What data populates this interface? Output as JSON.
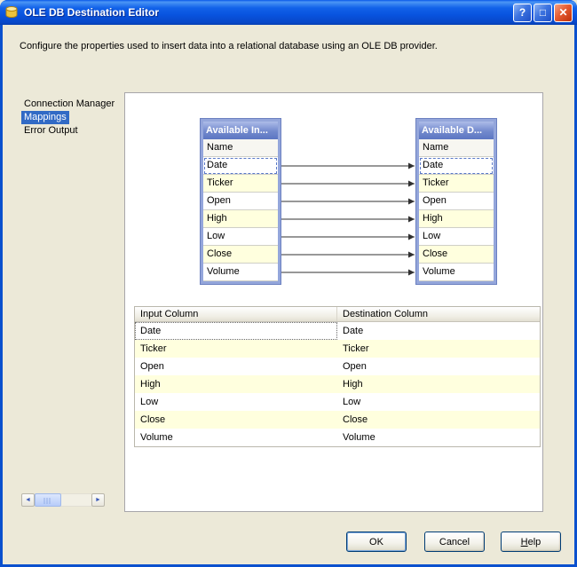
{
  "window": {
    "title": "OLE DB Destination Editor",
    "description": "Configure the properties used to insert data into a relational database using an OLE DB provider.",
    "controls": {
      "help_glyph": "?",
      "maximize_glyph": "□",
      "close_glyph": "✕"
    }
  },
  "sidebar": {
    "items": [
      {
        "label": "Connection Manager",
        "selected": false
      },
      {
        "label": "Mappings",
        "selected": true
      },
      {
        "label": "Error Output",
        "selected": false
      }
    ]
  },
  "mapping": {
    "source_box": {
      "title": "Available In...",
      "header": "Name",
      "rows": [
        "Date",
        "Ticker",
        "Open",
        "High",
        "Low",
        "Close",
        "Volume"
      ]
    },
    "dest_box": {
      "title": "Available D...",
      "header": "Name",
      "rows": [
        "Date",
        "Ticker",
        "Open",
        "High",
        "Low",
        "Close",
        "Volume"
      ]
    },
    "connections": [
      [
        "Date",
        "Date"
      ],
      [
        "Ticker",
        "Ticker"
      ],
      [
        "Open",
        "Open"
      ],
      [
        "High",
        "High"
      ],
      [
        "Low",
        "Low"
      ],
      [
        "Close",
        "Close"
      ],
      [
        "Volume",
        "Volume"
      ]
    ]
  },
  "grid": {
    "columns": [
      "Input Column",
      "Destination Column"
    ],
    "rows": [
      {
        "input": "Date",
        "destination": "Date"
      },
      {
        "input": "Ticker",
        "destination": "Ticker"
      },
      {
        "input": "Open",
        "destination": "Open"
      },
      {
        "input": "High",
        "destination": "High"
      },
      {
        "input": "Low",
        "destination": "Low"
      },
      {
        "input": "Close",
        "destination": "Close"
      },
      {
        "input": "Volume",
        "destination": "Volume"
      }
    ]
  },
  "scrollbar": {
    "left_glyph": "◄",
    "right_glyph": "►"
  },
  "buttons": {
    "ok": "OK",
    "cancel": "Cancel",
    "help": "Help"
  },
  "colors": {
    "selection": "#316AC5",
    "dialog_bg": "#ECE9D8",
    "row_alt": "#FFFFDE",
    "box_border": "#94A6DB",
    "titlebar_top": "#4A95F5",
    "titlebar_bottom": "#0747C6"
  }
}
